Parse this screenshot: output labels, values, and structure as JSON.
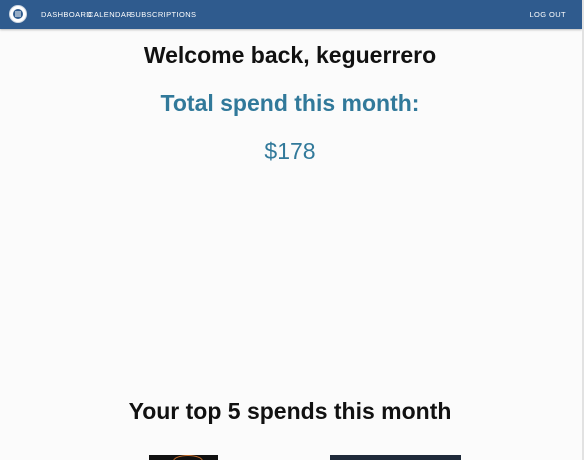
{
  "nav": {
    "logo_icon": "app-logo-icon",
    "dashboard": "DASHBOARD",
    "calendar": "CALENDAR",
    "subscriptions": "SUBSCRIPTIONS",
    "logout": "LOG OUT"
  },
  "main": {
    "welcome": "Welcome back, keguerrero",
    "spend_label": "Total spend this month:",
    "spend_value": "$178",
    "top_title": "Your top 5 spends this month"
  },
  "colors": {
    "navbar": "#2f5b8e",
    "accent": "#31799a"
  }
}
